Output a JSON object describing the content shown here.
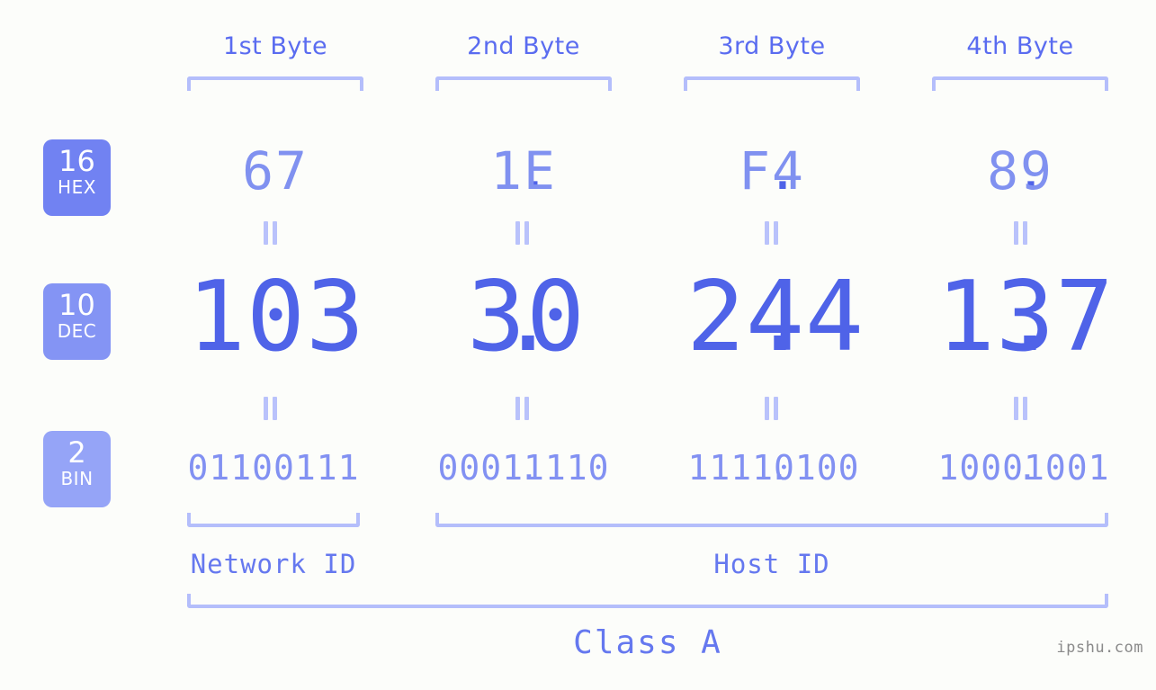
{
  "diagram": {
    "title": "IP address 103.30.244.137 byte breakdown",
    "byte_headers": [
      "1st Byte",
      "2nd Byte",
      "3rd Byte",
      "4th Byte"
    ],
    "bases": [
      {
        "number": "16",
        "name": "HEX",
        "color": "#7182f2"
      },
      {
        "number": "10",
        "name": "DEC",
        "color": "#8494f4"
      },
      {
        "number": "2",
        "name": "BIN",
        "color": "#95a4f7"
      }
    ],
    "rows": {
      "hex": {
        "values": [
          "67",
          "1E",
          "F4",
          "89"
        ],
        "separator": ".",
        "color": "#8091f0"
      },
      "dec": {
        "values": [
          "103",
          "30",
          "244",
          "137"
        ],
        "separator": ".",
        "color": "#4f63e8"
      },
      "bin": {
        "values": [
          "01100111",
          "00011110",
          "11110100",
          "10001001"
        ],
        "separator": ".",
        "color": "#8291f2"
      }
    },
    "equality_symbol": "=",
    "segments": {
      "network_id_label": "Network ID",
      "host_id_label": "Host ID"
    },
    "class_label": "Class A",
    "watermark": "ipshu.com",
    "colors": {
      "background": "#fcfdfa",
      "bracket": "#b4befb",
      "accent": "#4f63e8"
    }
  }
}
